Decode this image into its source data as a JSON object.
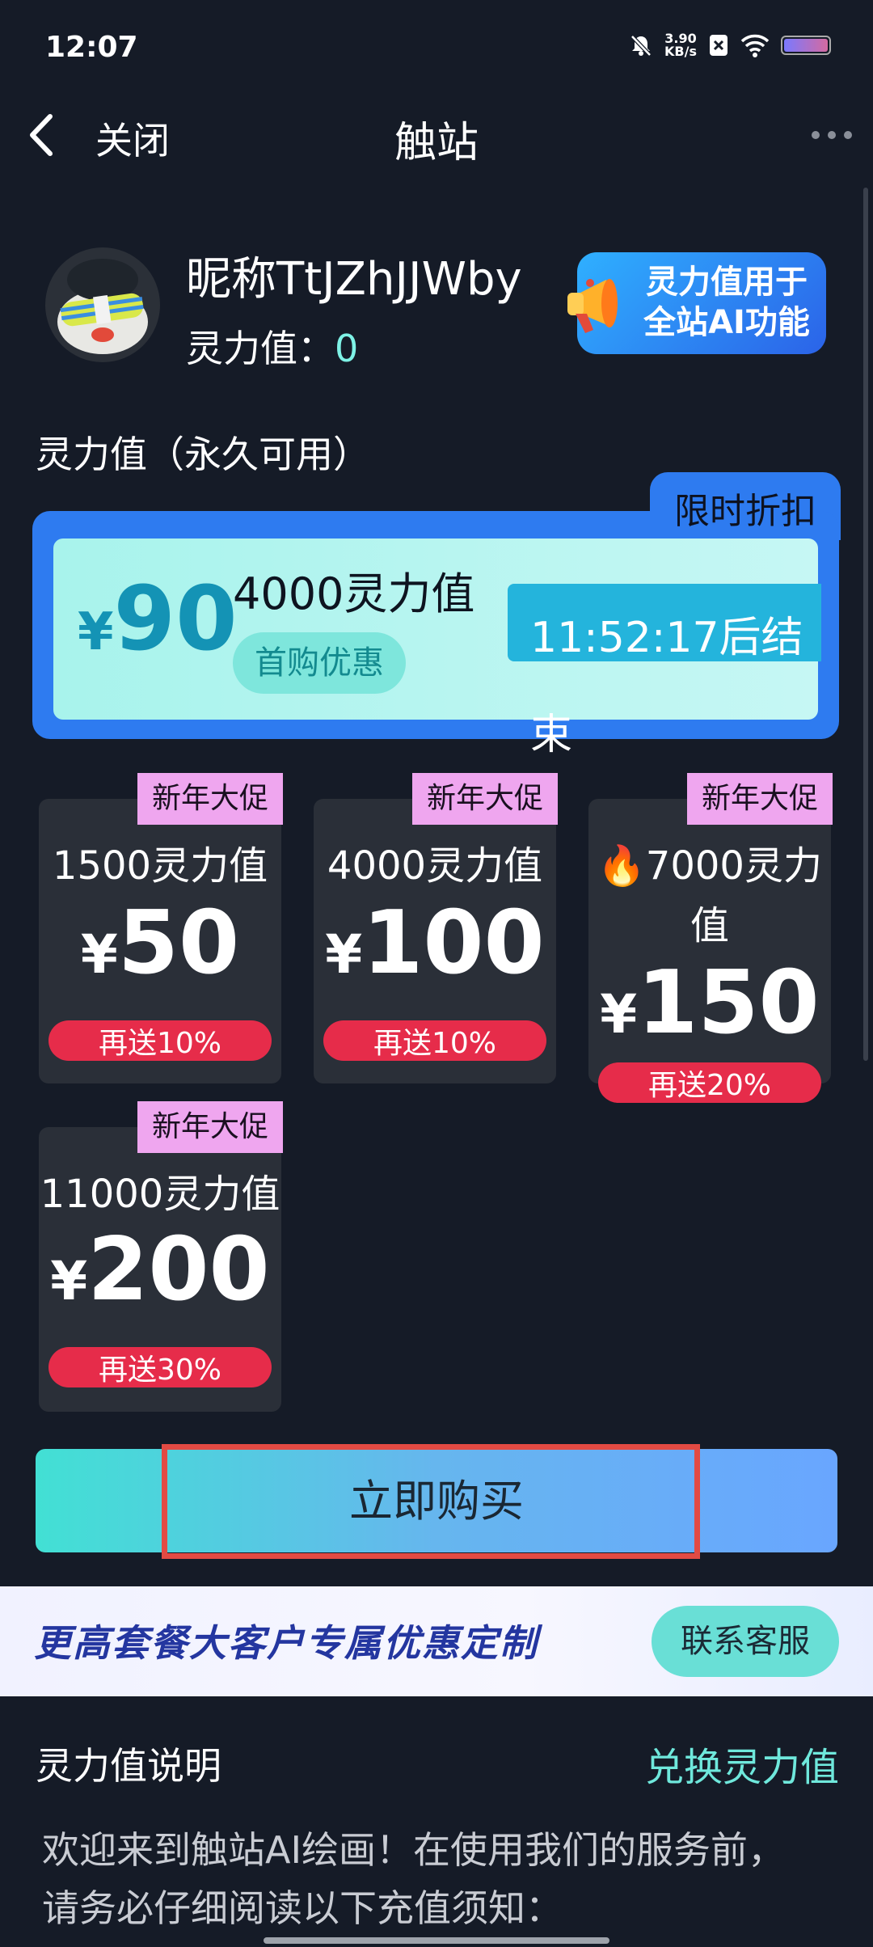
{
  "status_bar": {
    "time": "12:07",
    "net_speed": "3.90",
    "net_unit": "KB/s"
  },
  "nav": {
    "close_label": "关闭",
    "title": "触站"
  },
  "profile": {
    "nickname": "昵称TtJZhJJWby",
    "power_label": "灵力值：",
    "power_value": "0"
  },
  "promo": {
    "line1": "灵力值用于",
    "line2": "全站AI功能"
  },
  "section_title": "灵力值（永久可用）",
  "featured": {
    "tab": "限时折扣",
    "currency": "¥",
    "price": "90",
    "amount": "4000灵力值",
    "badge": "首购优惠",
    "timer": "11:52:17后结",
    "timer_wrap": "束"
  },
  "packages": [
    {
      "tag": "新年大促",
      "amount": "1500灵力值",
      "currency": "¥",
      "price": "50",
      "bonus": "再送10%"
    },
    {
      "tag": "新年大促",
      "amount": "4000灵力值",
      "currency": "¥",
      "price": "100",
      "bonus": "再送10%"
    },
    {
      "tag": "新年大促",
      "amount_line1": "🔥7000灵力",
      "amount_line2": "值",
      "currency": "¥",
      "price": "150",
      "bonus": "再送20%"
    },
    {
      "tag": "新年大促",
      "amount": "11000灵力值",
      "currency": "¥",
      "price": "200",
      "bonus": "再送30%"
    }
  ],
  "buy_button": "立即购买",
  "banner": {
    "text": "更高套餐大客户专属优惠定制",
    "contact": "联系客服"
  },
  "description": {
    "title": "灵力值说明",
    "exchange": "兑换灵力值",
    "line1": "欢迎来到触站AI绘画！在使用我们的服务前，",
    "line2": "请务必仔细阅读以下充值须知："
  },
  "colors": {
    "accent": "#6fe8dc",
    "card": "#2a2f38",
    "tag": "#efa6ef",
    "bonus": "#e62c4a",
    "featured_border": "#2e7bf0"
  }
}
